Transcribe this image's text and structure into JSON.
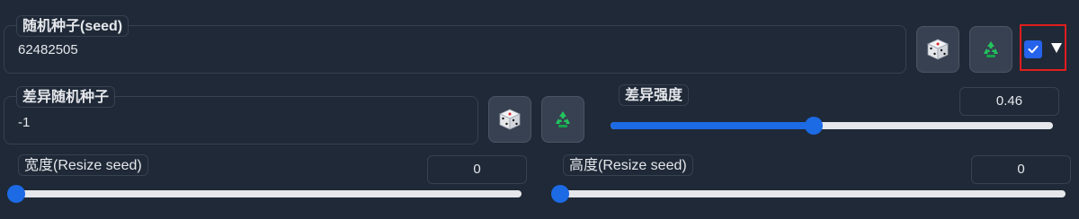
{
  "seed": {
    "label": "随机种子(seed)",
    "value": "62482505",
    "extra_checked": true
  },
  "variation_seed": {
    "label": "差异随机种子",
    "value": "-1"
  },
  "variation_strength": {
    "label": "差异强度",
    "value": "0.46",
    "fraction": 0.46
  },
  "resize_width": {
    "label": "宽度(Resize seed)",
    "value": "0",
    "fraction": 0
  },
  "resize_height": {
    "label": "高度(Resize seed)",
    "value": "0",
    "fraction": 0
  },
  "icons": {
    "random": "dice-icon",
    "reuse": "recycle-icon",
    "checkbox": "checkbox-icon",
    "expand": "triangle-down-icon"
  },
  "colors": {
    "accent": "#1d6ae5",
    "highlight_border": "#e11d1d",
    "recycle": "#22c55e"
  }
}
